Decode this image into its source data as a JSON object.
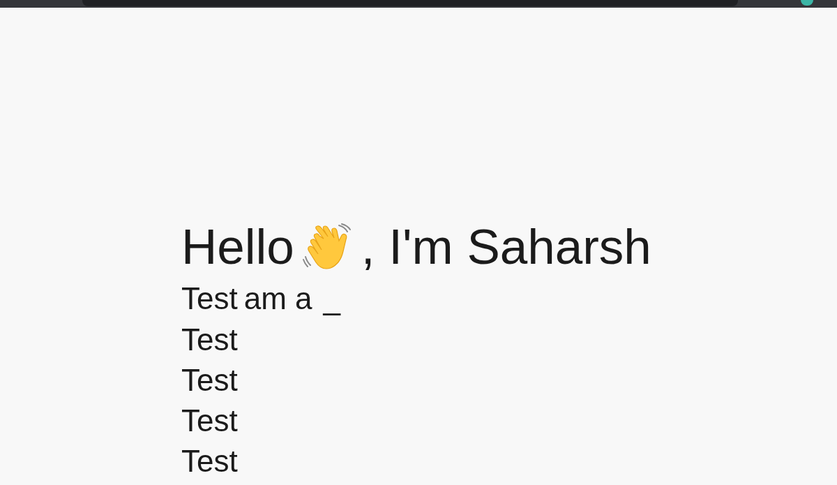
{
  "hero": {
    "greeting": "Hello",
    "greeting_rest": ", I'm Saharsh",
    "tagline": "am a",
    "cursor": "_"
  },
  "items": [
    "Test",
    "Test",
    "Test",
    "Test",
    "Test"
  ]
}
